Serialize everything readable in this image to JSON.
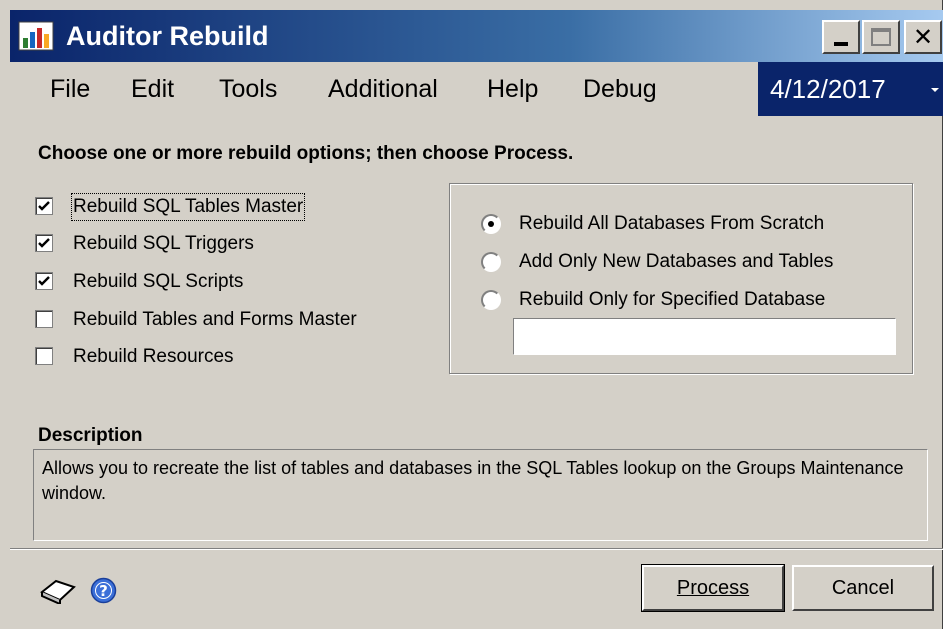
{
  "window": {
    "title": "Auditor Rebuild",
    "title_bar_buttons": [
      "minimize",
      "maximize",
      "close"
    ]
  },
  "menu": {
    "items": [
      "File",
      "Edit",
      "Tools",
      "Additional",
      "Help",
      "Debug"
    ],
    "date": "4/12/2017"
  },
  "options": {
    "heading": "Choose one or more rebuild options; then choose Process.",
    "checkboxes": [
      {
        "label": "Rebuild SQL Tables Master",
        "checked": true
      },
      {
        "label": "Rebuild SQL Triggers",
        "checked": true
      },
      {
        "label": "Rebuild SQL Scripts",
        "checked": true
      },
      {
        "label": "Rebuild Tables and Forms Master",
        "checked": false
      },
      {
        "label": "Rebuild Resources",
        "checked": false
      }
    ]
  },
  "scope": {
    "radios": [
      {
        "label": "Rebuild All Databases From Scratch",
        "selected": true
      },
      {
        "label": "Add Only New Databases and Tables",
        "selected": false
      },
      {
        "label": "Rebuild Only for Specified Database",
        "selected": false
      }
    ],
    "database_value": ""
  },
  "description": {
    "heading": "Description",
    "text": "Allows you to recreate the list of tables and databases in the SQL Tables lookup on the Groups Maintenance window."
  },
  "footer": {
    "icons": [
      "note-icon",
      "help-icon"
    ],
    "process_label": "Process",
    "cancel_label": "Cancel"
  },
  "colors": {
    "title_start": "#0a246a",
    "title_end": "#a6caf0",
    "window_bg": "#d4d0c8",
    "date_bg": "#0a246a"
  }
}
